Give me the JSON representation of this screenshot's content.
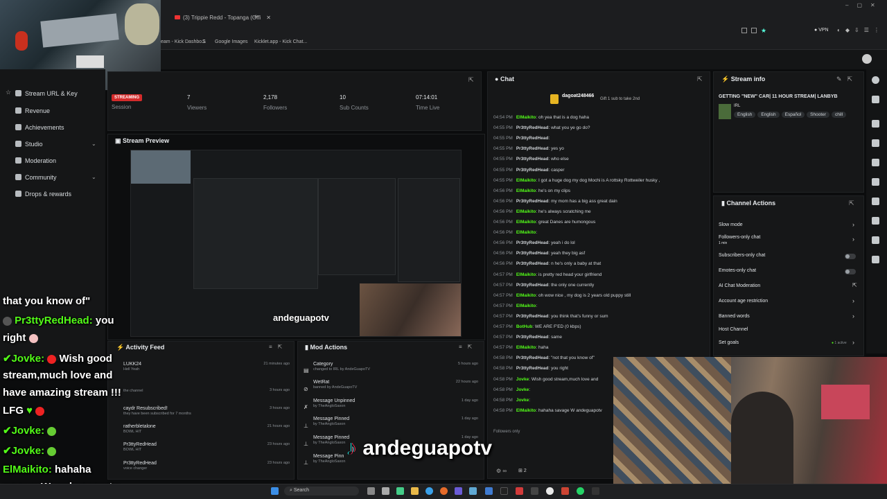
{
  "browser": {
    "tab_title": "(3) Trippie Redd - Topanga (Offi",
    "new_tab": "+",
    "bookmarks": [
      "eam - Kick Dashbo...",
      "Google Images",
      "Kicklet.app - Kick Chat..."
    ],
    "vpn": "VPN"
  },
  "sidebar": {
    "items": [
      {
        "label": "Stream URL & Key"
      },
      {
        "label": "Revenue"
      },
      {
        "label": "Achievements"
      },
      {
        "label": "Studio"
      },
      {
        "label": "Moderation"
      },
      {
        "label": "Community"
      },
      {
        "label": "Drops & rewards"
      }
    ]
  },
  "session": {
    "badge": "STREAMING",
    "stats": [
      {
        "value": "",
        "label": "Session"
      },
      {
        "value": "7",
        "label": "Viewers"
      },
      {
        "value": "2,178",
        "label": "Followers"
      },
      {
        "value": "10",
        "label": "Sub Counts"
      },
      {
        "value": "07:14:01",
        "label": "Time Live"
      }
    ]
  },
  "preview": {
    "title": "Stream Preview",
    "watermark": "andeguapotv"
  },
  "chat": {
    "title": "Chat",
    "pinned_user": "dagoat248466",
    "pinned_text": "Gift 1 sub to take 2nd",
    "messages": [
      {
        "time": "04:54 PM",
        "user": "ElMaikito",
        "text": "oh yea that is a dog haha"
      },
      {
        "time": "04:55 PM",
        "user": "Pr3ttyRedHead",
        "text": "what you ye go do?"
      },
      {
        "time": "04:55 PM",
        "user": "Pr3ttyRedHead",
        "text": ""
      },
      {
        "time": "04:55 PM",
        "user": "Pr3ttyRedHead",
        "text": "yes yo"
      },
      {
        "time": "04:55 PM",
        "user": "Pr3ttyRedHead",
        "text": "who else"
      },
      {
        "time": "04:55 PM",
        "user": "Pr3ttyRedHead",
        "text": "casper"
      },
      {
        "time": "04:55 PM",
        "user": "ElMaikito",
        "text": "I got a huge dog my dog Mochi is A rottsky Rottweiler husky ,"
      },
      {
        "time": "04:56 PM",
        "user": "ElMaikito",
        "text": "he's on my clips"
      },
      {
        "time": "04:56 PM",
        "user": "Pr3ttyRedHead",
        "text": "my mom has a big ass great dain"
      },
      {
        "time": "04:56 PM",
        "user": "ElMaikito",
        "text": "he's always scratching me"
      },
      {
        "time": "04:56 PM",
        "user": "ElMaikito",
        "text": "great Danes are humongous"
      },
      {
        "time": "04:56 PM",
        "user": "ElMaikito",
        "text": ""
      },
      {
        "time": "04:56 PM",
        "user": "Pr3ttyRedHead",
        "text": "yeah i do lol"
      },
      {
        "time": "04:56 PM",
        "user": "Pr3ttyRedHead",
        "text": "yeah they big asf"
      },
      {
        "time": "04:56 PM",
        "user": "Pr3ttyRedHead",
        "text": "n he's only a baby at that"
      },
      {
        "time": "04:57 PM",
        "user": "ElMaikito",
        "text": "is pretty red head your girlfriend"
      },
      {
        "time": "04:57 PM",
        "user": "Pr3ttyRedHead",
        "text": "the only one currently"
      },
      {
        "time": "04:57 PM",
        "user": "ElMaikito",
        "text": "oh wow nice , my dog is 2 years old puppy still"
      },
      {
        "time": "04:57 PM",
        "user": "ElMaikito",
        "text": ""
      },
      {
        "time": "04:57 PM",
        "user": "Pr3ttyRedHead",
        "text": "you think that's funny or sum"
      },
      {
        "time": "04:57 PM",
        "user": "BotHub",
        "text": "WE ARE F'ED (0 kbps)"
      },
      {
        "time": "04:57 PM",
        "user": "Pr3ttyRedHead",
        "text": "same"
      },
      {
        "time": "04:57 PM",
        "user": "ElMaikito",
        "text": "haha"
      },
      {
        "time": "04:58 PM",
        "user": "Pr3ttyRedHead",
        "text": "\"not that you know of\""
      },
      {
        "time": "04:58 PM",
        "user": "Pr3ttyRedHead",
        "text": "you right"
      },
      {
        "time": "04:58 PM",
        "user": "Jovke",
        "text": "Wish good stream,much love and"
      },
      {
        "time": "04:58 PM",
        "user": "Jovke",
        "text": ""
      },
      {
        "time": "04:58 PM",
        "user": "Jovke",
        "text": ""
      },
      {
        "time": "04:58 PM",
        "user": "ElMaikito",
        "text": "hahaha savage W andeguapotv"
      }
    ],
    "footer": "Followers only",
    "footer_count": "2"
  },
  "stream_info": {
    "title": "Stream info",
    "stream_title": "GETTING \"NEW\" CAR| 11 HOUR STREAM| LANBYB",
    "category": "IRL",
    "tags": [
      "English",
      "English",
      "Español",
      "Shooter",
      "chill"
    ]
  },
  "channel_actions": {
    "title": "Channel Actions",
    "items": [
      {
        "label": "Slow mode",
        "sub": ""
      },
      {
        "label": "Followers-only chat",
        "sub": "1 min"
      },
      {
        "label": "Subscribers-only chat",
        "sub": ""
      },
      {
        "label": "Emotes-only chat",
        "sub": ""
      },
      {
        "label": "AI Chat Moderation",
        "sub": ""
      },
      {
        "label": "Account age restriction",
        "sub": ""
      },
      {
        "label": "Banned words",
        "sub": ""
      },
      {
        "label": "Host Channel",
        "sub": ""
      },
      {
        "label": "Set goals",
        "sub": "1 active"
      }
    ]
  },
  "activity": {
    "title": "Activity Feed",
    "rows": [
      {
        "name": "LUKK24",
        "sub": "Hell Yeah",
        "time": "21 minutes ago"
      },
      {
        "name": "",
        "sub": "the channel",
        "time": "3 hours ago"
      },
      {
        "name": "caydr Resubscribed!",
        "sub": "they have been subscribed for 7 months",
        "time": "3 hours ago"
      },
      {
        "name": "ratherbletalone",
        "sub": "BOWL HIT",
        "time": "21 hours ago"
      },
      {
        "name": "Pr3ttyRedHead",
        "sub": "BOWL HIT",
        "time": "23 hours ago"
      },
      {
        "name": "Pr3ttyRedHead",
        "sub": "voice changer",
        "time": "23 hours ago"
      }
    ]
  },
  "mod_actions": {
    "title": "Mod Actions",
    "rows": [
      {
        "name": "Category",
        "sub": "changed to IRL by AndeGuapoTV",
        "time": "5 hours ago"
      },
      {
        "name": "WetRat",
        "sub": "banned by AndeGuapoTV",
        "time": "22 hours ago"
      },
      {
        "name": "Message Unpinned",
        "sub": "by TheAngloSaxon",
        "time": "1 day ago"
      },
      {
        "name": "Message Pinned",
        "sub": "by TheAngloSaxon",
        "time": "1 day ago"
      },
      {
        "name": "Message Pinned",
        "sub": "by TheAngloSaxon",
        "time": "1 day ago"
      },
      {
        "name": "Message Pinn",
        "sub": "by TheAngloSaxon",
        "time": ""
      }
    ]
  },
  "overlay": {
    "line1": "that you know of\"",
    "u2": "Pr3ttyRedHead:",
    "t2": " you",
    "line3": "right",
    "u4": "Jovke:",
    "t4": "Wish good",
    "line5": "stream,much love and",
    "line6": "have amazing stream !!!",
    "line7": "LFG",
    "u8": "Jovke:",
    "u9": "Jovke:",
    "u10": "ElMaikito:",
    "t10": " hahaha",
    "line11": "savage W andeguapotv",
    "brand": "andeguapotv"
  },
  "taskbar": {
    "search": "Search"
  },
  "colors": {
    "accent": "#53fc18",
    "streaming": "#d42b2b",
    "bg": "#0b0c0d"
  }
}
